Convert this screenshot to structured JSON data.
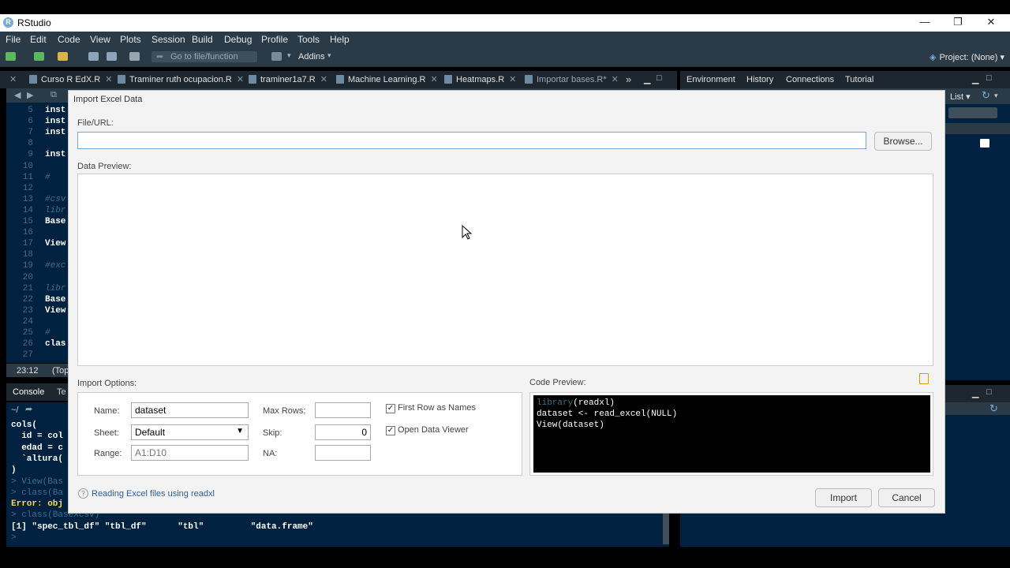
{
  "window": {
    "title": "RStudio",
    "minimize": "—",
    "restore": "❐",
    "close": "✕"
  },
  "menu": [
    "File",
    "Edit",
    "Code",
    "View",
    "Plots",
    "Session",
    "Build",
    "Debug",
    "Profile",
    "Tools",
    "Help"
  ],
  "toolbar": {
    "goto_placeholder": "Go to file/function",
    "addins": "Addins",
    "project": "Project: (None)"
  },
  "editor_tabs": [
    {
      "label": "Curso R EdX.R"
    },
    {
      "label": "Traminer ruth ocupacion.R"
    },
    {
      "label": "traminer1a7.R"
    },
    {
      "label": "Machine Learning.R"
    },
    {
      "label": "Heatmaps.R"
    },
    {
      "label": "Importar bases.R*"
    }
  ],
  "right_tabs": [
    "Environment",
    "History",
    "Connections",
    "Tutorial"
  ],
  "right_panel": {
    "list_label": "List"
  },
  "editor": {
    "lines": [
      {
        "n": "5",
        "code": "inst",
        "type": "code"
      },
      {
        "n": "6",
        "code": "inst",
        "type": "code"
      },
      {
        "n": "7",
        "code": "inst",
        "type": "code"
      },
      {
        "n": "8",
        "code": "",
        "type": "code"
      },
      {
        "n": "9",
        "code": "inst",
        "type": "code"
      },
      {
        "n": "10",
        "code": "",
        "type": "code"
      },
      {
        "n": "11",
        "code": "#",
        "type": "cmt"
      },
      {
        "n": "12",
        "code": "",
        "type": "code"
      },
      {
        "n": "13",
        "code": "#csv",
        "type": "cmt"
      },
      {
        "n": "14",
        "code": "libr",
        "type": "cmt"
      },
      {
        "n": "15",
        "code": "Base",
        "type": "code"
      },
      {
        "n": "16",
        "code": "",
        "type": "code"
      },
      {
        "n": "17",
        "code": "View",
        "type": "code"
      },
      {
        "n": "18",
        "code": "",
        "type": "code"
      },
      {
        "n": "19",
        "code": "#exc",
        "type": "cmt"
      },
      {
        "n": "20",
        "code": "",
        "type": "code"
      },
      {
        "n": "21",
        "code": "libr",
        "type": "cmt"
      },
      {
        "n": "22",
        "code": "Base",
        "type": "code"
      },
      {
        "n": "23",
        "code": "View",
        "type": "code"
      },
      {
        "n": "24",
        "code": "",
        "type": "code"
      },
      {
        "n": "25",
        "code": "#",
        "type": "cmt"
      },
      {
        "n": "26",
        "code": "clas",
        "type": "code"
      },
      {
        "n": "27",
        "code": "",
        "type": "code"
      }
    ],
    "status_pos": "23:12",
    "status_scope": "(Top"
  },
  "console": {
    "tab": "Console",
    "tab2": "Te",
    "path": "~/",
    "lines": [
      {
        "text": "cols(",
        "type": "out"
      },
      {
        "text": "  id = col",
        "type": "out"
      },
      {
        "text": "  edad = c",
        "type": "out"
      },
      {
        "text": "  `altura(",
        "type": "out"
      },
      {
        "text": ")",
        "type": "out"
      },
      {
        "text": "> View(Bas",
        "type": "dim"
      },
      {
        "text": "> class(Ba",
        "type": "dim"
      },
      {
        "text": "Error: obj",
        "type": "err"
      },
      {
        "text": "> class(BaseXcsv)",
        "type": "dim"
      },
      {
        "text": "[1] \"spec_tbl_df\" \"tbl_df\"      \"tbl\"         \"data.frame\"",
        "type": "out"
      },
      {
        "text": ">",
        "type": "dim"
      }
    ]
  },
  "dialog": {
    "title": "Import Excel Data",
    "file_url_label": "File/URL:",
    "file_url_value": "",
    "browse": "Browse...",
    "data_preview_label": "Data Preview:",
    "import_options_label": "Import Options:",
    "code_preview_label": "Code Preview:",
    "name_label": "Name:",
    "name_value": "dataset",
    "sheet_label": "Sheet:",
    "sheet_value": "Default",
    "range_label": "Range:",
    "range_placeholder": "A1:D10",
    "max_rows_label": "Max Rows:",
    "max_rows_value": "",
    "skip_label": "Skip:",
    "skip_value": "0",
    "na_label": "NA:",
    "na_value": "",
    "first_row_label": "First Row as Names",
    "first_row_checked": true,
    "open_viewer_label": "Open Data Viewer",
    "open_viewer_checked": true,
    "code_lines": [
      {
        "fn": "library",
        "rest": "(readxl)"
      },
      {
        "fn": "",
        "rest": "dataset <- read_excel(NULL)"
      },
      {
        "fn": "",
        "rest": "View(dataset)"
      }
    ],
    "help_link": "Reading Excel files using readxl",
    "import_button": "Import",
    "cancel_button": "Cancel"
  }
}
